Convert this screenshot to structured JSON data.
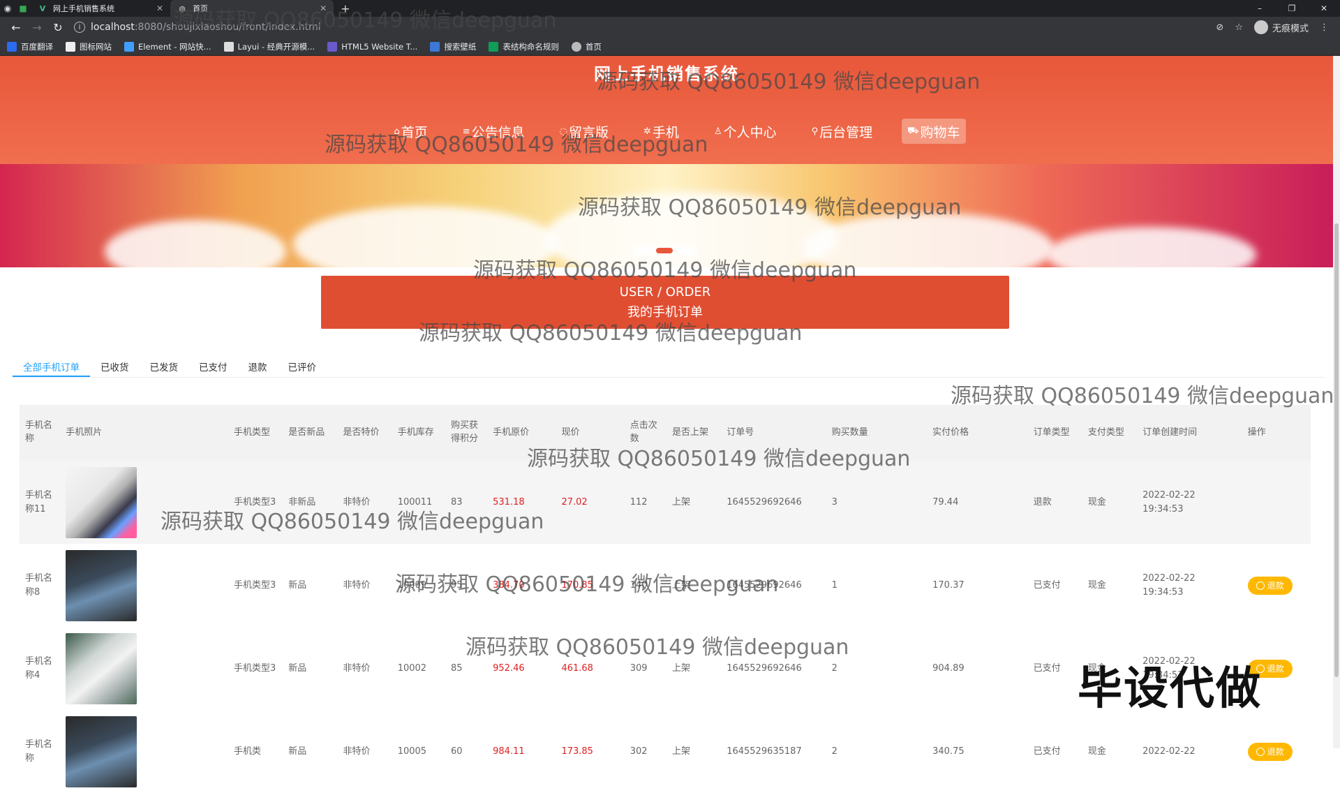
{
  "browser": {
    "tabs": [
      {
        "label": "网上手机销售系统",
        "active": false
      },
      {
        "label": "首页",
        "active": true
      }
    ],
    "url_host": "localhost",
    "url_path": ":8080/shoujixiaoshou/front/index.html",
    "profile_label": "无痕模式",
    "bookmarks": [
      "百度翻译",
      "图标网站",
      "Element - 网站快...",
      "Layui - 经典开源模...",
      "HTML5 Website T...",
      "搜索壁纸",
      "表结构命名规则",
      "首页"
    ]
  },
  "site": {
    "title": "网上手机销售系统",
    "nav": [
      {
        "label": "首页",
        "icon": "home-icon"
      },
      {
        "label": "公告信息",
        "icon": "list-icon"
      },
      {
        "label": "留言版",
        "icon": "message-icon"
      },
      {
        "label": "手机",
        "icon": "phone-icon"
      },
      {
        "label": "个人中心",
        "icon": "user-icon"
      },
      {
        "label": "后台管理",
        "icon": "link-icon"
      },
      {
        "label": "购物车",
        "icon": "cart-icon"
      }
    ]
  },
  "section": {
    "en": "USER / ORDER",
    "cn": "我的手机订单"
  },
  "order_tabs": [
    "全部手机订单",
    "已收货",
    "已发货",
    "已支付",
    "退款",
    "已评价"
  ],
  "table": {
    "headers": [
      "手机名称",
      "手机照片",
      "手机类型",
      "是否新品",
      "是否特价",
      "手机库存",
      "购买获得积分",
      "手机原价",
      "现价",
      "点击次数",
      "是否上架",
      "订单号",
      "购买数量",
      "实付价格",
      "订单类型",
      "支付类型",
      "订单创建时间",
      "操作"
    ],
    "rows": [
      {
        "name": "手机名称11",
        "type": "手机类型3",
        "is_new": "非新品",
        "is_special": "非特价",
        "stock": "100011",
        "points": "83",
        "orig_price": "531.18",
        "price": "27.02",
        "clicks": "112",
        "on_shelf": "上架",
        "order_no": "1645529692646",
        "qty": "3",
        "paid": "79.44",
        "order_type": "退款",
        "pay_type": "现金",
        "created": "2022-02-22 19:34:53",
        "action": ""
      },
      {
        "name": "手机名称8",
        "type": "手机类型3",
        "is_new": "新品",
        "is_special": "非特价",
        "stock": "10009",
        "points": "95",
        "orig_price": "384.70",
        "price": "170.85",
        "clicks": "140",
        "on_shelf": "上架",
        "order_no": "1645529692646",
        "qty": "1",
        "paid": "170.37",
        "order_type": "已支付",
        "pay_type": "现金",
        "created": "2022-02-22 19:34:53",
        "action": "退款"
      },
      {
        "name": "手机名称4",
        "type": "手机类型3",
        "is_new": "新品",
        "is_special": "非特价",
        "stock": "10002",
        "points": "85",
        "orig_price": "952.46",
        "price": "461.68",
        "clicks": "309",
        "on_shelf": "上架",
        "order_no": "1645529692646",
        "qty": "2",
        "paid": "904.89",
        "order_type": "已支付",
        "pay_type": "现金",
        "created": "2022-02-22 19:34:53",
        "action": "退款"
      },
      {
        "name": "手机名称",
        "type": "手机类",
        "is_new": "新品",
        "is_special": "非特价",
        "stock": "10005",
        "points": "60",
        "orig_price": "984.11",
        "price": "173.85",
        "clicks": "302",
        "on_shelf": "上架",
        "order_no": "1645529635187",
        "qty": "2",
        "paid": "340.75",
        "order_type": "已支付",
        "pay_type": "现金",
        "created": "2022-02-22",
        "action": "退款"
      }
    ]
  },
  "watermark": "源码获取 QQ86050149 微信deepguan",
  "stamp": "毕设代做",
  "colors": {
    "brand": "#e8573a",
    "tab_active": "#1e9fff",
    "price": "#e02020",
    "refund_button": "#ffb800"
  }
}
